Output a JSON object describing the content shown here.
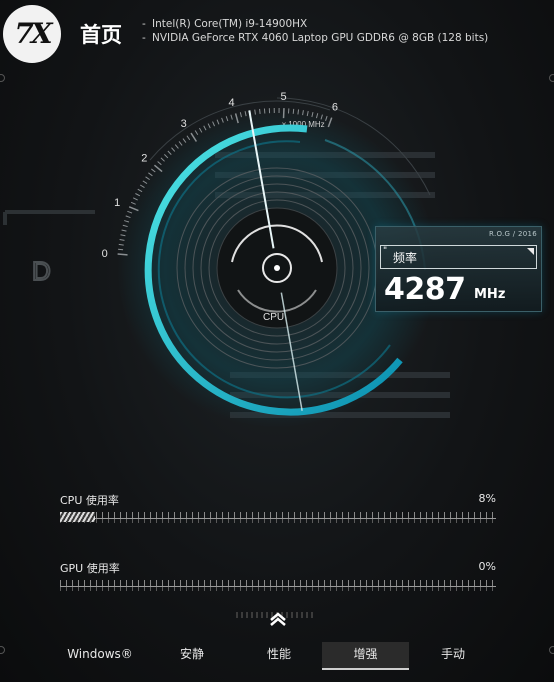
{
  "header": {
    "page_title": "首页",
    "specs": [
      "Intel(R) Core(TM) i9-14900HX",
      "NVIDIA GeForce RTX 4060 Laptop GPU GDDR6 @ 8GB (128 bits)"
    ]
  },
  "gauge": {
    "scale_labels": [
      "0",
      "1",
      "2",
      "3",
      "4",
      "5",
      "6"
    ],
    "unit_label": "x 1000 MHz",
    "center_label": "CPU",
    "needle_value_ghz": 4.287,
    "accent_color": "#18d0e0",
    "side_glyph": "D"
  },
  "frequency": {
    "tag": "R.O.G / 2016",
    "label": "频率",
    "value": "4287",
    "unit": "MHz"
  },
  "usage": {
    "cpu": {
      "name": "CPU 使用率",
      "percent_text": "8%",
      "percent": 8
    },
    "gpu": {
      "name": "GPU 使用率",
      "percent_text": "0%",
      "percent": 0
    }
  },
  "modes": {
    "items": [
      "Windows®",
      "安静",
      "性能",
      "增强",
      "手动"
    ],
    "active": "增强"
  },
  "icons": {
    "logo": "7x-logo",
    "expand": "chevron-up-icon"
  }
}
